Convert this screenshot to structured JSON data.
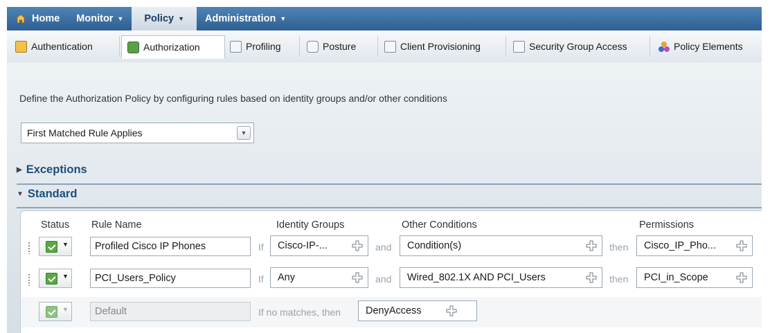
{
  "nav": {
    "items": [
      {
        "label": "Home",
        "has_caret": false
      },
      {
        "label": "Monitor",
        "has_caret": true
      },
      {
        "label": "Policy",
        "has_caret": true,
        "active": true
      },
      {
        "label": "Administration",
        "has_caret": true
      }
    ]
  },
  "tabs": [
    {
      "label": "Authentication",
      "icon": "authentication-icon"
    },
    {
      "label": "Authorization",
      "icon": "authorization-icon",
      "active": true
    },
    {
      "label": "Profiling",
      "icon": "profiling-icon"
    },
    {
      "label": "Posture",
      "icon": "posture-icon"
    },
    {
      "label": "Client Provisioning",
      "icon": "client-provisioning-icon"
    },
    {
      "label": "Security Group Access",
      "icon": "security-group-icon"
    },
    {
      "label": "Policy Elements",
      "icon": "policy-elements-icon"
    }
  ],
  "description": "Define the Authorization Policy by configuring rules based on identity groups and/or other conditions",
  "match_mode": {
    "selected": "First Matched Rule Applies"
  },
  "sections": {
    "exceptions": "Exceptions",
    "standard": "Standard"
  },
  "table": {
    "headers": {
      "status": "Status",
      "rule_name": "Rule Name",
      "identity_groups": "Identity Groups",
      "other_conditions": "Other Conditions",
      "permissions": "Permissions"
    },
    "rows": [
      {
        "rule_name": "Profiled Cisco IP Phones",
        "if": "If",
        "identity": "Cisco-IP-...",
        "and": "and",
        "condition": "Condition(s)",
        "then": "then",
        "permission": "Cisco_IP_Pho...",
        "enabled": true
      },
      {
        "rule_name": "PCI_Users_Policy",
        "if": "If",
        "identity": "Any",
        "and": "and",
        "condition": "Wired_802.1X AND PCI_Users",
        "then": "then",
        "permission": "PCI_in_Scope",
        "enabled": true
      }
    ],
    "default": {
      "rule_name": "Default",
      "text": "If no matches, then",
      "permission": "DenyAccess"
    }
  },
  "colors": {
    "nav_top": "#4f84b6",
    "nav_bottom": "#2e5f92",
    "section_title": "#1d4f7d",
    "check_green": "#59a845"
  }
}
